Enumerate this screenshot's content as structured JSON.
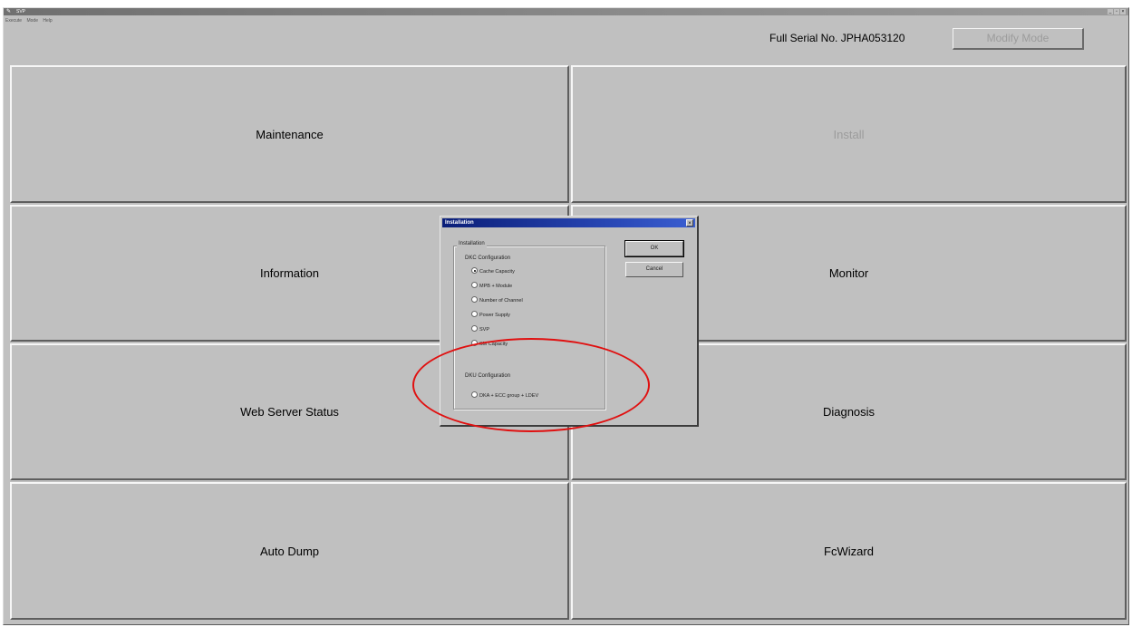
{
  "window": {
    "title": "SVP",
    "controls": [
      "_",
      "▫",
      "×"
    ],
    "menu": [
      "Execute",
      "Mode",
      "Help"
    ]
  },
  "header": {
    "serial_text": "Full Serial No. JPHA053120",
    "modify_mode_label": "Modify Mode"
  },
  "main_buttons": {
    "maintenance": "Maintenance",
    "install": "Install",
    "information": "Information",
    "monitor": "Monitor",
    "web_server_status": "Web Server Status",
    "diagnosis": "Diagnosis",
    "auto_dump": "Auto Dump",
    "fcwizard": "FcWizard"
  },
  "dialog": {
    "title": "Installation",
    "close": "×",
    "group_label": "Installation",
    "dkc_label": "DKC Configuration",
    "dkc_options": [
      {
        "label": "Cache Capacity",
        "selected": true
      },
      {
        "label": "MPB + Module",
        "selected": false
      },
      {
        "label": "Number of Channel",
        "selected": false
      },
      {
        "label": "Power Supply",
        "selected": false
      },
      {
        "label": "SVP",
        "selected": false
      },
      {
        "label": "SM Capacity",
        "selected": false
      }
    ],
    "dku_label": "DKU Configuration",
    "dku_options": [
      {
        "label": "DKA + ECC group + LDEV",
        "selected": false
      }
    ],
    "ok_label": "OK",
    "cancel_label": "Cancel"
  },
  "colors": {
    "highlight": "#e01010",
    "dialog_title": "#0a1e78",
    "window_face": "#c0c0c0"
  }
}
